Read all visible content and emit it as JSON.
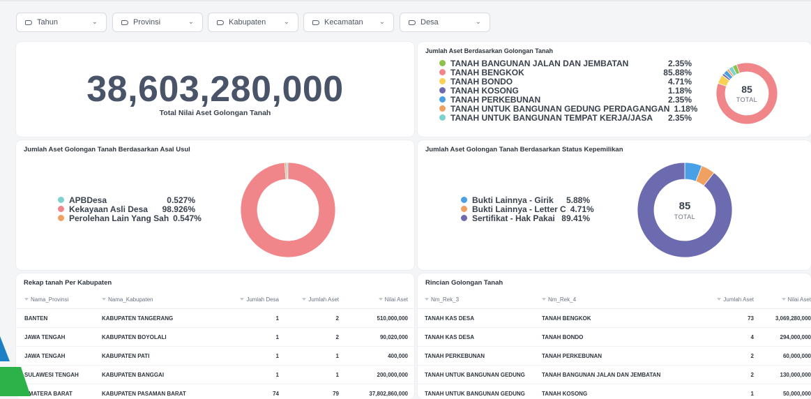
{
  "filters": [
    {
      "label": "Tahun"
    },
    {
      "label": "Provinsi"
    },
    {
      "label": "Kabupaten"
    },
    {
      "label": "Kecamatan"
    },
    {
      "label": "Desa"
    }
  ],
  "total_card": {
    "value": "38,603,280,000",
    "label": "Total Nilai Aset Golongan Tanah"
  },
  "golongan_card": {
    "title": "Jumlah Aset Berdasarkan Golongan Tanah",
    "legend": [
      {
        "name": "TANAH BANGUNAN JALAN DAN JEMBATAN",
        "pct": "2.35%",
        "color": "#8bc34a"
      },
      {
        "name": "TANAH BENGKOK",
        "pct": "85.88%",
        "color": "#f0868a"
      },
      {
        "name": "TANAH BONDO",
        "pct": "4.71%",
        "color": "#f8d155"
      },
      {
        "name": "TANAH KOSONG",
        "pct": "1.18%",
        "color": "#6d6bb0"
      },
      {
        "name": "TANAH PERKEBUNAN",
        "pct": "2.35%",
        "color": "#4aa0e6"
      },
      {
        "name": "TANAH UNTUK BANGUNAN GEDUNG PERDAGANGAN",
        "pct": "1.18%",
        "color": "#f0a060"
      },
      {
        "name": "TANAH UNTUK BANGUNAN TEMPAT KERJA/JASA",
        "pct": "2.35%",
        "color": "#7fd1d0"
      }
    ],
    "center_value": "85",
    "center_label": "TOTAL"
  },
  "asal_card": {
    "title": "Jumlah Aset Golongan Tanah Berdasarkan Asal Usul",
    "legend": [
      {
        "name": "APBDesa",
        "pct": "0.527%",
        "color": "#7fd1d0"
      },
      {
        "name": "Kekayaan Asli Desa",
        "pct": "98.926%",
        "color": "#f0868a"
      },
      {
        "name": "Perolehan Lain Yang Sah",
        "pct": "0.547%",
        "color": "#f0a060"
      }
    ]
  },
  "status_card": {
    "title": "Jumlah Aset Golongan Tanah Berdasarkan Status Kepemilikan",
    "legend": [
      {
        "name": "Bukti Lainnya - Girik",
        "pct": "5.88%",
        "color": "#4aa0e6"
      },
      {
        "name": "Bukti Lainnya - Letter C",
        "pct": "4.71%",
        "color": "#f0a060"
      },
      {
        "name": "Sertifikat - Hak Pakai",
        "pct": "89.41%",
        "color": "#6d6bb0"
      }
    ],
    "center_value": "85",
    "center_label": "TOTAL"
  },
  "rekap_card": {
    "title": "Rekap tanah Per Kabupaten",
    "columns": [
      "Nama_Provinsi",
      "Nama_Kabupaten",
      "Jumlah Desa",
      "Jumlah Aset",
      "Nilai Aset"
    ],
    "rows": [
      [
        "BANTEN",
        "KABUPATEN TANGERANG",
        "1",
        "2",
        "510,000,000"
      ],
      [
        "JAWA TENGAH",
        "KABUPATEN BOYOLALI",
        "1",
        "2",
        "90,020,000"
      ],
      [
        "JAWA TENGAH",
        "KABUPATEN PATI",
        "1",
        "1",
        "400,000"
      ],
      [
        "SULAWESI TENGAH",
        "KABUPATEN BANGGAI",
        "1",
        "1",
        "200,000,000"
      ],
      [
        "UMATERA BARAT",
        "KABUPATEN PASAMAN BARAT",
        "74",
        "79",
        "37,802,860,000"
      ]
    ]
  },
  "rincian_card": {
    "title": "Rincian Golongan Tanah",
    "columns": [
      "Nm_Rek_3",
      "Nm_Rek_4",
      "Jumlah Aset",
      "Nilai Aset"
    ],
    "rows": [
      [
        "TANAH KAS DESA",
        "TANAH BENGKOK",
        "73",
        "3,069,280,000"
      ],
      [
        "TANAH KAS DESA",
        "TANAH BONDO",
        "4",
        "294,000,000"
      ],
      [
        "TANAH PERKEBUNAN",
        "TANAH PERKEBUNAN",
        "2",
        "60,000,000"
      ],
      [
        "TANAH UNTUK BANGUNAN GEDUNG",
        "TANAH BANGUNAN JALAN DAN JEMBATAN",
        "2",
        "130,000,000"
      ],
      [
        "TANAH UNTUK BANGUNAN GEDUNG",
        "TANAH KOSONG",
        "1",
        "50,000,000"
      ]
    ]
  }
}
